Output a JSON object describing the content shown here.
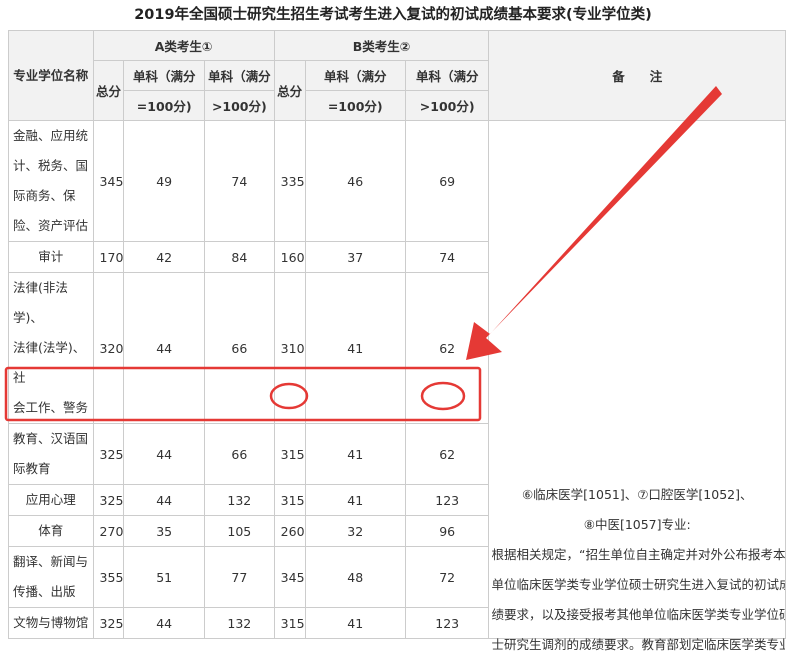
{
  "title": "2019年全国硕士研究生招生考试考生进入复试的初试成绩基本要求(专业学位类)",
  "header": {
    "name_col": "专业学位名称",
    "group_a": "A类考生①",
    "group_b": "B类考生②",
    "total": "总分",
    "single_eq100_line1": "单科（满分",
    "single_eq100_line2": "=100分)",
    "single_gt100_line1": "单科（满分",
    "single_gt100_line2": ">100分)",
    "remarks": "备　　注"
  },
  "rows": [
    {
      "name_lines": [
        "金融、应用统",
        "计、税务、国",
        "际商务、保",
        "险、资产评估"
      ],
      "a_total": "345",
      "a_100": "49",
      "a_gt": "74",
      "b_total": "335",
      "b_100": "46",
      "b_gt": "69"
    },
    {
      "name_lines": [
        "审计"
      ],
      "a_total": "170",
      "a_100": "42",
      "a_gt": "84",
      "b_total": "160",
      "b_100": "37",
      "b_gt": "74"
    },
    {
      "name_lines": [
        "法律(非法学)、",
        "法律(法学)、社",
        "会工作、警务"
      ],
      "a_total": "320",
      "a_100": "44",
      "a_gt": "66",
      "b_total": "310",
      "b_100": "41",
      "b_gt": "62"
    },
    {
      "name_lines": [
        "教育、汉语国",
        "际教育"
      ],
      "a_total": "325",
      "a_100": "44",
      "a_gt": "66",
      "b_total": "315",
      "b_100": "41",
      "b_gt": "62"
    },
    {
      "name_lines": [
        "应用心理"
      ],
      "a_total": "325",
      "a_100": "44",
      "a_gt": "132",
      "b_total": "315",
      "b_100": "41",
      "b_gt": "123"
    },
    {
      "name_lines": [
        "体育"
      ],
      "a_total": "270",
      "a_100": "35",
      "a_gt": "105",
      "b_total": "260",
      "b_100": "32",
      "b_gt": "96"
    },
    {
      "name_lines": [
        "翻译、新闻与",
        "传播、出版"
      ],
      "a_total": "355",
      "a_100": "51",
      "a_gt": "77",
      "b_total": "345",
      "b_100": "48",
      "b_gt": "72"
    },
    {
      "name_lines": [
        "文物与博物馆"
      ],
      "a_total": "325",
      "a_100": "44",
      "a_gt": "132",
      "b_total": "315",
      "b_100": "41",
      "b_gt": "123"
    }
  ],
  "remarks": {
    "line1": "⑥临床医学[1051]、⑦口腔医学[1052]、",
    "line2": "⑧中医[1057]专业:",
    "line3": "根据相关规定，“招生单位自主确定并对外公布报考本",
    "line4": "单位临床医学类专业学位硕士研究生进入复试的初试成",
    "line5": "绩要求，以及接受报考其他单位临床医学类专业学位硕",
    "line6": "士研究生调剂的成绩要求。教育部划定临床医学类专业"
  },
  "annotation_color": "#e53935"
}
